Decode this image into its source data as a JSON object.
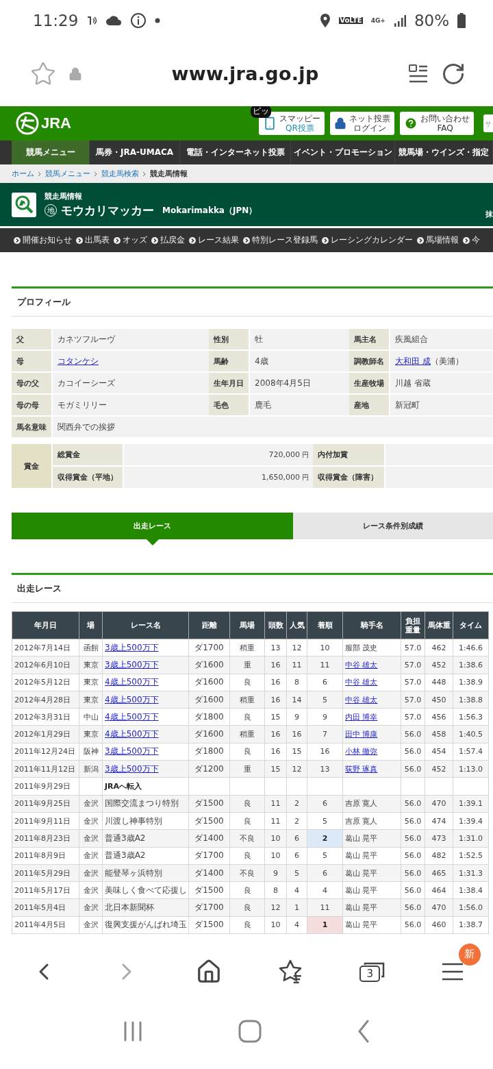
{
  "status_bar": {
    "time": "11:29",
    "volte": "VoLTE",
    "network": "4G+",
    "battery": "80%"
  },
  "browser": {
    "url": "www.jra.go.jp",
    "tab_count": "3",
    "menu_badge": "新"
  },
  "header": {
    "logo_text": "JRA",
    "badge": "ピッ",
    "buttons": [
      {
        "kind": "phone",
        "lines": [
          "スマッピー",
          "QR投票"
        ]
      },
      {
        "kind": "lock",
        "lines": [
          "ネット投票",
          "ログイン"
        ]
      },
      {
        "kind": "help",
        "lines": [
          "お問い合わせ",
          "FAQ"
        ]
      }
    ],
    "search_placeholder": "サ"
  },
  "main_nav": [
    {
      "label": "競馬メニュー",
      "selected": true
    },
    {
      "label": "馬券・JRA-UMACA",
      "selected": false
    },
    {
      "label": "電話・インターネット投票",
      "selected": false
    },
    {
      "label": "イベント・プロモーション",
      "selected": false
    },
    {
      "label": "競馬場・ウインズ・指定",
      "selected": false
    }
  ],
  "breadcrumb": [
    {
      "label": "ホーム",
      "link": true
    },
    {
      "label": "競馬メニュー",
      "link": true
    },
    {
      "label": "競走馬検索",
      "link": true
    },
    {
      "label": "競走馬情報",
      "link": false
    }
  ],
  "title": {
    "caption": "競走馬情報",
    "mark": "地",
    "name": "モウカリマッカー",
    "roman": "Mokarimakka（JPN）",
    "side": "抹"
  },
  "sub_nav": [
    "開催お知らせ",
    "出馬表",
    "オッズ",
    "払戻金",
    "レース結果",
    "特別レース登録馬",
    "レーシングカレンダー",
    "馬場情報",
    "今"
  ],
  "profile": {
    "heading": "プロフィール",
    "rows": [
      [
        {
          "label": "父",
          "value": "カネツフルーヴ",
          "link": false
        },
        {
          "label": "性別",
          "value": "牡",
          "link": false
        },
        {
          "label": "馬主名",
          "value": "疾風組合",
          "link": false
        }
      ],
      [
        {
          "label": "母",
          "value": "コタンケシ",
          "link": true
        },
        {
          "label": "馬齢",
          "value": "4歳",
          "link": false
        },
        {
          "label": "調教師名",
          "value": "大和田 成",
          "link": true,
          "suffix": "（美浦）"
        }
      ],
      [
        {
          "label": "母の父",
          "value": "カコイーシーズ",
          "link": false
        },
        {
          "label": "生年月日",
          "value": "2008年4月5日",
          "link": false
        },
        {
          "label": "生産牧場",
          "value": "川越 省蔵",
          "link": false
        }
      ],
      [
        {
          "label": "母の母",
          "value": "モガミリリー",
          "link": false
        },
        {
          "label": "毛色",
          "value": "鹿毛",
          "link": false
        },
        {
          "label": "産地",
          "value": "新冠町",
          "link": false
        }
      ],
      [
        {
          "label": "馬名意味",
          "value": "関西弁での挨拶",
          "link": false
        }
      ]
    ]
  },
  "prize": {
    "label": "賞金",
    "rows": [
      {
        "label": "総賞金",
        "amount": "720,000",
        "unit": "円",
        "label_2": "内付加賞"
      },
      {
        "label": "収得賞金（平地）",
        "amount": "1,650,000",
        "unit": "円",
        "label_2": "収得賞金（障害）"
      }
    ]
  },
  "tabs": [
    {
      "label": "出走レース",
      "selected": true
    },
    {
      "label": "レース条件別成績",
      "selected": false
    }
  ],
  "races": {
    "heading": "出走レース",
    "columns": [
      "年月日",
      "場",
      "レース名",
      "距離",
      "馬場",
      "頭数",
      "人気",
      "着順",
      "騎手名",
      "負担重量",
      "馬体重",
      "タイム"
    ],
    "rows": [
      {
        "kind": "race",
        "date": "2012年7月14日",
        "venue": "函館",
        "race": "3歳上500万下",
        "race_link": true,
        "distance": "ダ1700",
        "going": "稍重",
        "runners": "13",
        "popularity": "12",
        "finish": "10",
        "jockey": "服部 茂史",
        "jockey_link": false,
        "weight": "57.0",
        "body_weight": "462",
        "time": "1:46.6"
      },
      {
        "kind": "race",
        "date": "2012年6月10日",
        "venue": "東京",
        "race": "3歳上500万下",
        "race_link": true,
        "distance": "ダ1600",
        "going": "重",
        "runners": "16",
        "popularity": "11",
        "finish": "11",
        "jockey": "中谷 雄太",
        "jockey_link": true,
        "weight": "57.0",
        "body_weight": "452",
        "time": "1:38.6"
      },
      {
        "kind": "race",
        "date": "2012年5月12日",
        "venue": "東京",
        "race": "4歳上500万下",
        "race_link": true,
        "distance": "ダ1600",
        "going": "良",
        "runners": "16",
        "popularity": "8",
        "finish": "6",
        "jockey": "中谷 雄太",
        "jockey_link": true,
        "weight": "57.0",
        "body_weight": "448",
        "time": "1:38.9"
      },
      {
        "kind": "race",
        "date": "2012年4月28日",
        "venue": "東京",
        "race": "4歳上500万下",
        "race_link": true,
        "distance": "ダ1600",
        "going": "稍重",
        "runners": "16",
        "popularity": "14",
        "finish": "5",
        "jockey": "中谷 雄太",
        "jockey_link": true,
        "weight": "57.0",
        "body_weight": "450",
        "time": "1:38.8"
      },
      {
        "kind": "race",
        "date": "2012年3月31日",
        "venue": "中山",
        "race": "4歳上500万下",
        "race_link": true,
        "distance": "ダ1800",
        "going": "良",
        "runners": "15",
        "popularity": "9",
        "finish": "9",
        "jockey": "内田 博幸",
        "jockey_link": true,
        "weight": "57.0",
        "body_weight": "456",
        "time": "1:56.3"
      },
      {
        "kind": "race",
        "date": "2012年1月29日",
        "venue": "東京",
        "race": "4歳上500万下",
        "race_link": true,
        "distance": "ダ1600",
        "going": "稍重",
        "runners": "16",
        "popularity": "16",
        "finish": "7",
        "jockey": "田中 博康",
        "jockey_link": true,
        "weight": "56.0",
        "body_weight": "458",
        "time": "1:40.5"
      },
      {
        "kind": "race",
        "date": "2011年12月24日",
        "venue": "阪神",
        "race": "3歳上500万下",
        "race_link": true,
        "distance": "ダ1800",
        "going": "良",
        "runners": "16",
        "popularity": "15",
        "finish": "16",
        "jockey": "小林 徹弥",
        "jockey_link": true,
        "weight": "56.0",
        "body_weight": "454",
        "time": "1:57.4"
      },
      {
        "kind": "race",
        "date": "2011年11月12日",
        "venue": "新潟",
        "race": "3歳上500万下",
        "race_link": true,
        "distance": "ダ1200",
        "going": "重",
        "runners": "15",
        "popularity": "12",
        "finish": "13",
        "jockey": "荻野 琢真",
        "jockey_link": true,
        "weight": "56.0",
        "body_weight": "452",
        "time": "1:13.0"
      },
      {
        "kind": "transfer",
        "date": "2011年9月29日",
        "note": "JRAへ転入"
      },
      {
        "kind": "race",
        "date": "2011年9月25日",
        "venue": "金沢",
        "race": "国際交流まつり特別",
        "race_link": false,
        "distance": "ダ1500",
        "going": "良",
        "runners": "11",
        "popularity": "2",
        "finish": "6",
        "jockey": "吉原 寛人",
        "jockey_link": false,
        "weight": "56.0",
        "body_weight": "470",
        "time": "1:39.1"
      },
      {
        "kind": "race",
        "date": "2011年9月11日",
        "venue": "金沢",
        "race": "川渡し神事特別",
        "race_link": false,
        "distance": "ダ1500",
        "going": "良",
        "runners": "11",
        "popularity": "2",
        "finish": "5",
        "jockey": "吉原 寛人",
        "jockey_link": false,
        "weight": "56.0",
        "body_weight": "474",
        "time": "1:39.4"
      },
      {
        "kind": "race",
        "date": "2011年8月23日",
        "venue": "金沢",
        "race": "普通3歳A2",
        "race_link": false,
        "distance": "ダ1400",
        "going": "不良",
        "runners": "10",
        "popularity": "6",
        "finish": "2",
        "color": "#dbeaf6",
        "jockey": "葛山 晃平",
        "jockey_link": false,
        "weight": "56.0",
        "body_weight": "473",
        "time": "1:31.0"
      },
      {
        "kind": "race",
        "date": "2011年8月9日",
        "venue": "金沢",
        "race": "普通3歳A2",
        "race_link": false,
        "distance": "ダ1700",
        "going": "良",
        "runners": "10",
        "popularity": "6",
        "finish": "5",
        "jockey": "葛山 晃平",
        "jockey_link": false,
        "weight": "56.0",
        "body_weight": "482",
        "time": "1:52.5"
      },
      {
        "kind": "race",
        "date": "2011年5月29日",
        "venue": "金沢",
        "race": "能登琴ヶ浜特別",
        "race_link": false,
        "distance": "ダ1400",
        "going": "不良",
        "runners": "9",
        "popularity": "5",
        "finish": "6",
        "jockey": "葛山 晃平",
        "jockey_link": false,
        "weight": "56.0",
        "body_weight": "465",
        "time": "1:31.3"
      },
      {
        "kind": "race",
        "date": "2011年5月17日",
        "venue": "金沢",
        "race": "美味しく食べて応援し",
        "race_link": false,
        "distance": "ダ1500",
        "going": "良",
        "runners": "8",
        "popularity": "4",
        "finish": "4",
        "jockey": "葛山 晃平",
        "jockey_link": false,
        "weight": "56.0",
        "body_weight": "464",
        "time": "1:38.4"
      },
      {
        "kind": "race",
        "date": "2011年5月4日",
        "venue": "金沢",
        "race": "北日本新聞杯",
        "race_link": false,
        "distance": "ダ1700",
        "going": "良",
        "runners": "12",
        "popularity": "1",
        "finish": "11",
        "jockey": "葛山 晃平",
        "jockey_link": false,
        "weight": "56.0",
        "body_weight": "470",
        "time": "1:56.0"
      },
      {
        "kind": "race",
        "date": "2011年4月5日",
        "venue": "金沢",
        "race": "復興支援がんばれ埼玉",
        "race_link": false,
        "distance": "ダ1500",
        "going": "良",
        "runners": "10",
        "popularity": "4",
        "finish": "1",
        "color": "#f7dede",
        "jockey": "葛山 晃平",
        "jockey_link": false,
        "weight": "56.0",
        "body_weight": "460",
        "time": "1:38.7"
      }
    ]
  }
}
